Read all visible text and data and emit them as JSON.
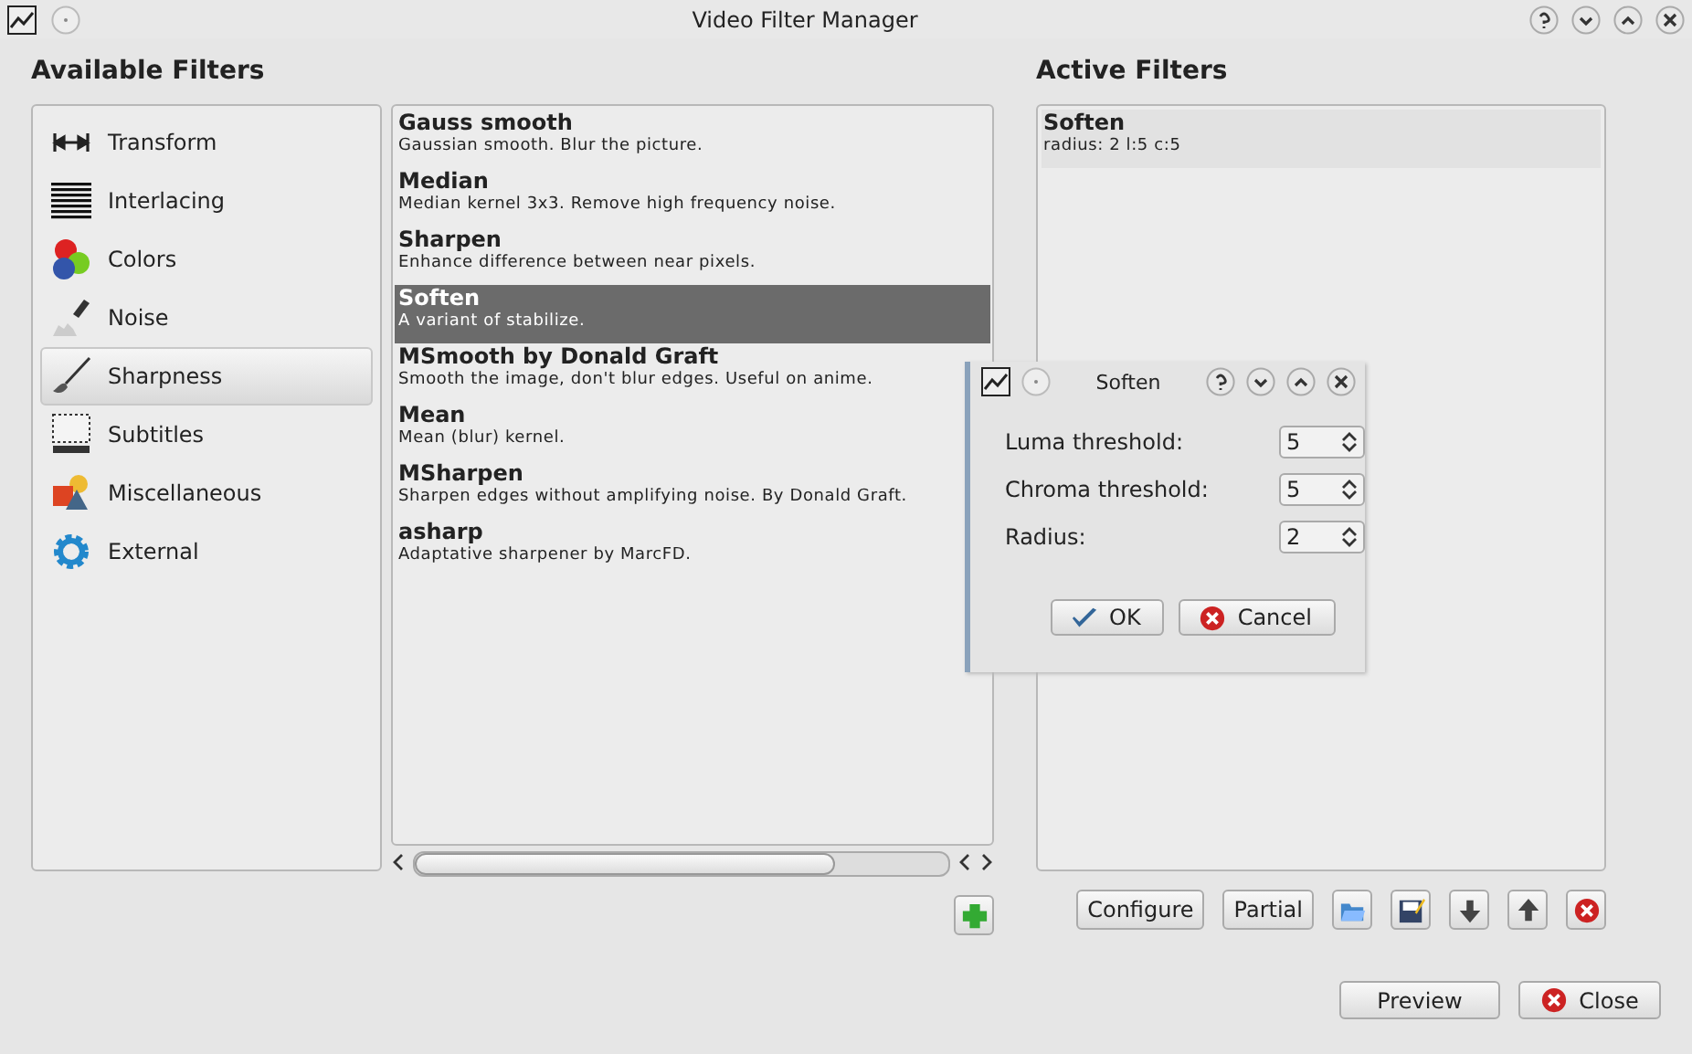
{
  "window": {
    "title": "Video Filter Manager"
  },
  "available": {
    "heading": "Available Filters",
    "categories": [
      {
        "label": "Transform",
        "selected": false
      },
      {
        "label": "Interlacing",
        "selected": false
      },
      {
        "label": "Colors",
        "selected": false
      },
      {
        "label": "Noise",
        "selected": false
      },
      {
        "label": "Sharpness",
        "selected": true
      },
      {
        "label": "Subtitles",
        "selected": false
      },
      {
        "label": "Miscellaneous",
        "selected": false
      },
      {
        "label": "External",
        "selected": false
      }
    ],
    "filters": [
      {
        "name": "Gauss smooth",
        "description": "Gaussian smooth. Blur the picture.",
        "selected": false
      },
      {
        "name": "Median",
        "description": "Median kernel 3x3. Remove high frequency noise.",
        "selected": false
      },
      {
        "name": "Sharpen",
        "description": "Enhance difference between near pixels.",
        "selected": false
      },
      {
        "name": "Soften",
        "description": "A variant of stabilize.",
        "selected": true
      },
      {
        "name": "MSmooth by Donald Graft",
        "description": "Smooth the image, don't blur edges. Useful on anime.",
        "selected": false
      },
      {
        "name": "Mean",
        "description": "Mean (blur) kernel.",
        "selected": false
      },
      {
        "name": "MSharpen",
        "description": "Sharpen edges without amplifying noise. By Donald Graft.",
        "selected": false
      },
      {
        "name": "asharp",
        "description": "Adaptative sharpener by MarcFD.",
        "selected": false
      }
    ]
  },
  "active": {
    "heading": "Active Filters",
    "filters": [
      {
        "name": "Soften",
        "description": "radius: 2 l:5 c:5"
      }
    ],
    "buttons": [
      {
        "label": "Configure"
      },
      {
        "label": "Partial"
      }
    ]
  },
  "footer": {
    "buttons": [
      {
        "label": "Preview"
      },
      {
        "label": "Close"
      }
    ]
  },
  "dialog": {
    "title": "Soften",
    "fields": [
      {
        "label": "Luma threshold:",
        "value": "5"
      },
      {
        "label": "Chroma threshold:",
        "value": "5"
      },
      {
        "label": "Radius:",
        "value": "2"
      }
    ],
    "buttons": [
      {
        "label": "OK"
      },
      {
        "label": "Cancel"
      }
    ]
  }
}
